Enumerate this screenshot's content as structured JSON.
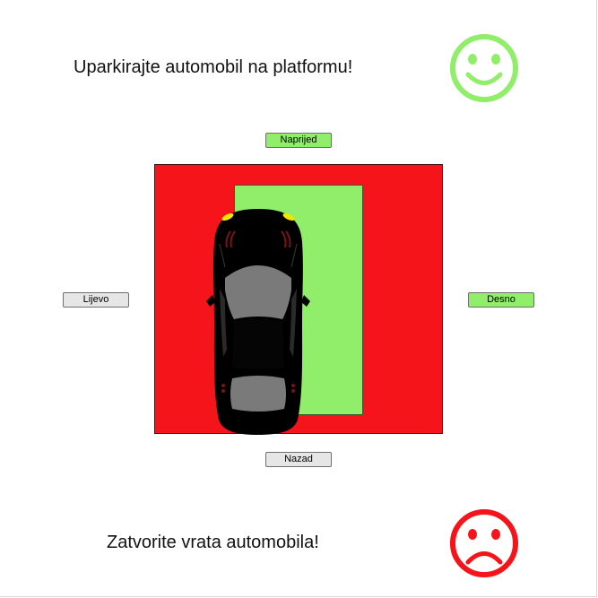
{
  "instructions": {
    "park": "Uparkirajte automobil na platformu!",
    "close_doors": "Zatvorite vrata automobila!"
  },
  "controls": {
    "forward": "Naprijed",
    "back": "Nazad",
    "left": "Lijevo",
    "right": "Desno"
  },
  "icons": {
    "happy": "happy-face-icon",
    "sad": "sad-face-icon",
    "car": "car-top-view-icon"
  },
  "colors": {
    "parking_area": "#f5141a",
    "platform": "#90ee6a",
    "happy_face": "#90ee6a",
    "sad_face": "#f5141a",
    "active_button": "#90ee6a",
    "inactive_button": "#e6e6e6"
  }
}
